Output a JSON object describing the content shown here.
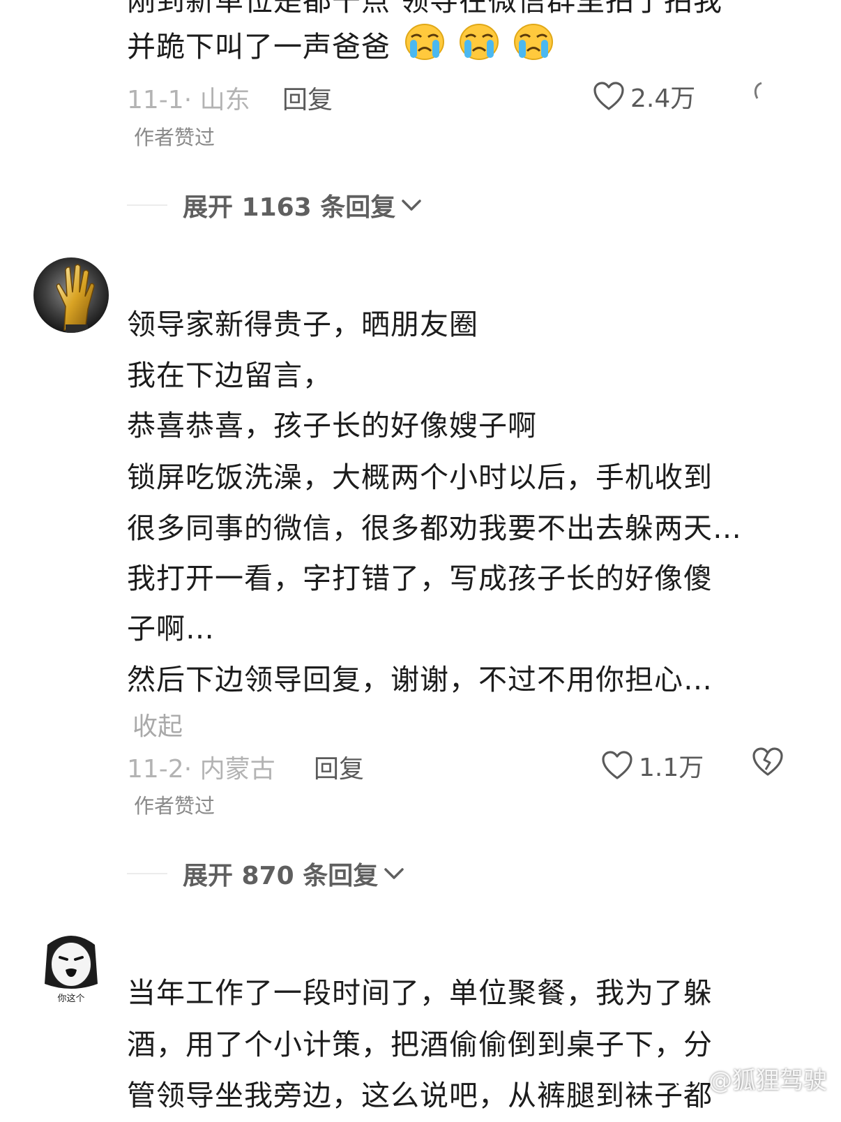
{
  "comments": [
    {
      "lines": [
        "刚到新单位是都干点 领导在微信群里拍了拍我",
        "并跪下叫了一声爸爸"
      ],
      "emojis": [
        "crying-face-icon",
        "crying-face-icon",
        "crying-face-icon"
      ],
      "date": "11-1",
      "location": "山东",
      "reply_label": "回复",
      "like_count": "2.4万",
      "author_liked": "作者赞过",
      "expand_label": "展开 1163 条回复"
    },
    {
      "lines": [
        "领导家新得贵子，晒朋友圈",
        "我在下边留言，",
        "恭喜恭喜，孩子长的好像嫂子啊",
        "锁屏吃饭洗澡，大概两个小时以后，手机收到",
        "很多同事的微信，很多都劝我要不出去躲两天…",
        "我打开一看，字打错了，写成孩子长的好像傻",
        "子啊…",
        "然后下边领导回复，谢谢，不过不用你担心…"
      ],
      "collapse_label": "收起",
      "date": "11-2",
      "location": "内蒙古",
      "reply_label": "回复",
      "like_count": "1.1万",
      "author_liked": "作者赞过",
      "expand_label": "展开 870 条回复"
    },
    {
      "avatar_caption": "你这个",
      "lines": [
        "当年工作了一段时间了，单位聚餐，我为了躲",
        "酒，用了个小计策，把酒偷偷倒到桌子下，分",
        "管领导坐我旁边，这么说吧，从裤腿到袜子都"
      ]
    }
  ],
  "watermark": "@狐狸驾驶",
  "colors": {
    "text": "#1c1c1c",
    "meta": "#b3b3b3",
    "secondary": "#5a5a5a",
    "background": "#ffffff"
  }
}
